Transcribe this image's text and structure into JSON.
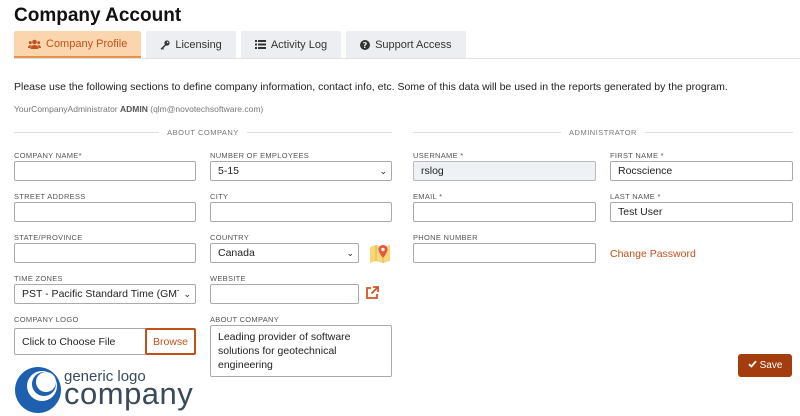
{
  "page_title": "Company Account",
  "tabs": [
    {
      "label": "Company Profile",
      "icon": "users-icon",
      "active": true
    },
    {
      "label": "Licensing",
      "icon": "key-icon",
      "active": false
    },
    {
      "label": "Activity Log",
      "icon": "list-icon",
      "active": false
    },
    {
      "label": "Support Access",
      "icon": "question-icon",
      "active": false
    }
  ],
  "intro": "Please use the following sections to define company information, contact info, etc. Some of this data will be used in the reports generated by the program.",
  "admin_line": {
    "prefix": "YourCompanyAdministrator",
    "role": "ADMIN",
    "email": "(qlm@novotechsoftware.com)"
  },
  "about_company": {
    "section_title": "ABOUT COMPANY",
    "company_name": {
      "label": "COMPANY NAME*",
      "value": ""
    },
    "employees": {
      "label": "NUMBER OF EMPLOYEES",
      "value": "5-15"
    },
    "street": {
      "label": "STREET ADDRESS",
      "value": ""
    },
    "city": {
      "label": "CITY",
      "value": ""
    },
    "state": {
      "label": "STATE/PROVINCE",
      "value": ""
    },
    "country": {
      "label": "COUNTRY",
      "value": "Canada"
    },
    "timezone": {
      "label": "TIME ZONES",
      "value": "PST - Pacific Standard Time (GMT-"
    },
    "website": {
      "label": "WEBSITE",
      "value": ""
    },
    "logo": {
      "label": "COMPANY LOGO",
      "file_text": "Click to Choose File",
      "browse": "Browse"
    },
    "about": {
      "label": "ABOUT COMPANY",
      "value": "Leading provider of software solutions for geotechnical engineering"
    }
  },
  "administrator": {
    "section_title": "ADMINISTRATOR",
    "username": {
      "label": "USERNAME *",
      "value": "rslog"
    },
    "first_name": {
      "label": "FIRST NAME *",
      "value": "Rocscience"
    },
    "email": {
      "label": "EMAIL *",
      "value": ""
    },
    "last_name": {
      "label": "LAST NAME *",
      "value": "Test User"
    },
    "phone": {
      "label": "PHONE NUMBER",
      "value": ""
    },
    "change_password": "Change Password"
  },
  "save_label": "Save",
  "company_logo_image": {
    "small": "generic logo",
    "big": "company"
  },
  "colors": {
    "accent": "#c2521a",
    "save": "#a33d0f",
    "active_tab": "#fbd5ae"
  }
}
